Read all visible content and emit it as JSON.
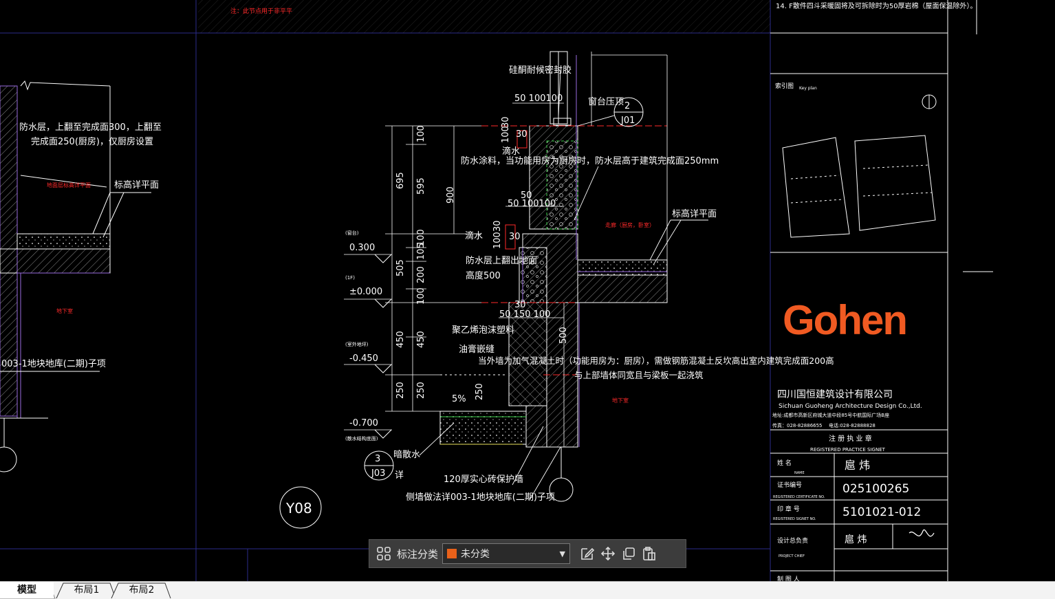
{
  "drawing": {
    "top_note": "注：此节点用于非平平",
    "left_detail": {
      "waterproof_note_1": "防水层，上翻至完成面300，上翻至",
      "waterproof_note_2": "完成面250(厨房)，仅厨房设置",
      "floor_label_red": "地面层标高详平面",
      "elevation_label": "标高详平面",
      "basement_red": "地下室",
      "ref_note": "003-1地块地库(二期)子项"
    },
    "main_detail": {
      "sealant": "硅酮耐候密封胶",
      "dims_top": "50 100100",
      "window_sill": "窗台压顶",
      "callout_top_num": "2",
      "callout_top_sheet": "J01",
      "drip1": "滴水",
      "waterproof_coating": "防水涂料，当功能用房为厨房时，防水层高于建筑完成面250mm",
      "dims_mid": "50 100100",
      "dim_50": "50",
      "drip2": "滴水",
      "waterproof_up": "防水层上翻出地面",
      "height_500": "高度500",
      "elevation_right": "标高详平面",
      "room_right_red": "走廊（厨房，卧室）",
      "eps_board": "聚乙烯泡沫塑料",
      "bitumen": "油膏嵌缝",
      "aerated_note": "当外墙为加气混凝土时（功能用房为：厨房），需做钢筋混凝土反坎高出室内建筑完成面200高",
      "aerated_note_2": "与上部墙体同宽且与梁板一起浇筑",
      "dims_bottom": "50 150 100",
      "dim_500": "500",
      "slope": "5%",
      "dim_250": "250",
      "basement_red_2": "地下室",
      "hidden_drain": "暗散水",
      "callout_bot_num": "3",
      "callout_bot_sheet": "J03",
      "detail_word": "详",
      "brick_wall": "120厚实心砖保护墙",
      "side_wall_note": "侧墙做法详003-1地块地库(二期)子项",
      "tag": "Y08",
      "levels": [
        {
          "tag": "(窗台)",
          "value": "0.300"
        },
        {
          "tag": "(1F)",
          "value": "±0.000"
        },
        {
          "tag": "(室外地坪)",
          "value": "-0.450"
        },
        {
          "tag": "(散水结构底面)",
          "value": "-0.700"
        }
      ],
      "vdims_outer": [
        "695",
        "505",
        "450",
        "250"
      ],
      "vdims_inner": [
        "100",
        "595",
        "100",
        "105",
        "200",
        "100",
        "450",
        "250"
      ],
      "vdim_900": "900",
      "small_dims": [
        "30",
        "100",
        "30",
        "30",
        "100",
        "30",
        "30"
      ]
    }
  },
  "title_block": {
    "note_top": "14. F散件四斗采暖固将及可拆除时为50厚岩棉（屋面保温除外）。",
    "key_plan_label": "索引图",
    "key_plan_en": "Key plan",
    "logo": "Gohen",
    "company_cn": "四川国恒建筑设计有限公司",
    "company_en": "Sichuan Guoheng Architecture Design Co.,Ltd.",
    "address": "地址:成都市高新区府城大道中段85号中航国际广场B座",
    "tel": "传真：028-82886655",
    "phone": "电话:028-82888828",
    "seal_title": "注 册 执 业 章",
    "seal_title_en": "REGISTERED PRACTICE SIGNET",
    "rows": [
      {
        "label": "姓  名",
        "label_en": "NAME",
        "value": "扈  炜"
      },
      {
        "label": "证书编号",
        "label_en": "REGISTERED CERTIFICATE NO.",
        "value": "025100265"
      },
      {
        "label": "印 章 号",
        "label_en": "REGISTERED SIGNET NO.",
        "value": "5101021-012"
      },
      {
        "label": "设计总负责",
        "label_en": "PROJECT CHIEF",
        "value": "扈  炜"
      },
      {
        "label": "制 图 人",
        "label_en": "",
        "value": ""
      }
    ]
  },
  "toolbar": {
    "label": "标注分类",
    "selected": "未分类",
    "swatch_color": "#e8611a"
  },
  "tabs": {
    "model": "模型",
    "layout1": "布局1",
    "layout2": "布局2"
  },
  "colors": {
    "background": "#000000",
    "outline": "#ffffff",
    "purple": "#9a6be0",
    "red": "#ff2a2a",
    "green": "#3cd04a",
    "yellow": "#e8e05a",
    "logo_orange": "#f05a22"
  }
}
